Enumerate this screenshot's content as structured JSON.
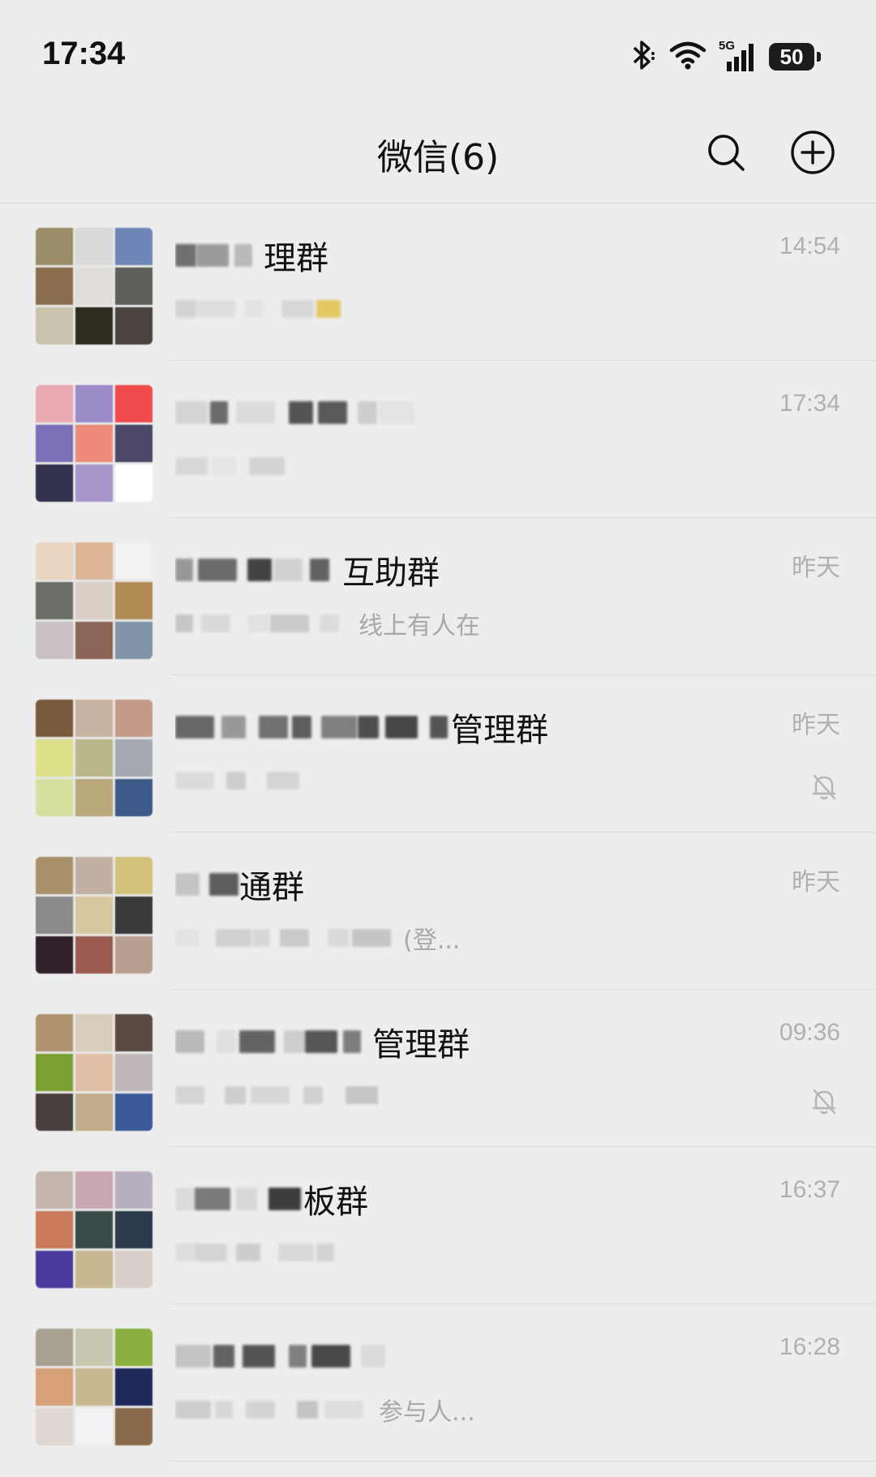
{
  "status_bar": {
    "time": "17:34",
    "icons": [
      "bluetooth-icon",
      "wifi-icon",
      "signal-5g-icon",
      "battery-icon"
    ],
    "network_label": "5G",
    "battery_level": "50"
  },
  "header": {
    "title": "微信(6)",
    "search_icon": "search-icon",
    "add_icon": "plus-circle-icon"
  },
  "chats": [
    {
      "name": "理群",
      "preview": "",
      "time": "14:54",
      "muted": false,
      "avatar_colors": [
        "#9b8c6a",
        "#d9d9d9",
        "#6f86b8",
        "#8b6e4e",
        "#e0dcd8",
        "#5c5e58",
        "#c9c2ad",
        "#2d2a20",
        "#4a423c"
      ],
      "name_blocks": [
        "#5a5a5a",
        "#8c8c8c",
        "#b0b0b0"
      ],
      "preview_blocks": [
        "#cfcfcf",
        "#dcdcdc",
        "#e2e2e2",
        "#d4d4d4",
        "#e3c24a"
      ]
    },
    {
      "name": "",
      "preview": "",
      "time": "17:34",
      "muted": false,
      "avatar_colors": [
        "#e8a9b2",
        "#9b8cc8",
        "#f24a4a",
        "#7b6fb5",
        "#ee8a7a",
        "#4a4866",
        "#33334d",
        "#a595c8",
        "#ffffff"
      ],
      "name_blocks": [
        "#d0d0d0",
        "#555555",
        "#dadada",
        "#3a3a3a",
        "#404040",
        "#c8c8c8",
        "#e2e2e2"
      ],
      "preview_blocks": [
        "#d4d4d4",
        "#e4e4e4",
        "#cfcfcf"
      ]
    },
    {
      "name": "互助群",
      "preview": "线上有人在",
      "time": "昨天",
      "muted": false,
      "avatar_colors": [
        "#e9d7c2",
        "#dcb697",
        "#f2f2f2",
        "#6a6e66",
        "#d9cec5",
        "#b08c54",
        "#c9c0c6",
        "#8c6456",
        "#7f94a6"
      ],
      "name_blocks": [
        "#8a8a8a",
        "#555555",
        "#262626",
        "#cdcdcd",
        "#4a4a4a"
      ],
      "preview_blocks": [
        "#c0c0c0",
        "#d6d6d6",
        "#e0e0e0",
        "#c4c4c4",
        "#dadada"
      ]
    },
    {
      "name": "管理群",
      "preview": "",
      "time": "昨天",
      "muted": true,
      "avatar_colors": [
        "#7a5a3a",
        "#c8b4a2",
        "#c49a8a",
        "#dce08a",
        "#b9b68a",
        "#a5aab2",
        "#d6e09e",
        "#b8a87a",
        "#3c5a8a"
      ],
      "name_blocks": [
        "#505050",
        "#8a8a8a",
        "#5c5c5c",
        "#454545",
        "#6c6c6c",
        "#333333",
        "#2a2a2a",
        "#3a3a3a"
      ],
      "preview_blocks": [
        "#d8d8d8",
        "#c8c8c8",
        "#d0d0d0"
      ]
    },
    {
      "name": "通群",
      "preview": "(登...",
      "time": "昨天",
      "muted": false,
      "avatar_colors": [
        "#a8906a",
        "#c2b0a2",
        "#d2c27a",
        "#8a8a8a",
        "#d8c8a0",
        "#3a3a3a",
        "#30202a",
        "#9a5a50",
        "#b8a090"
      ],
      "name_blocks": [
        "#bdbdbd",
        "#444444"
      ],
      "preview_blocks": [
        "#e2e2e2",
        "#cccccc",
        "#d4d4d4",
        "#c4c4c4",
        "#d6d6d6",
        "#bfbfbf"
      ]
    },
    {
      "name": "管理群",
      "preview": "",
      "time": "09:36",
      "muted": true,
      "avatar_colors": [
        "#b09470",
        "#d8cdb8",
        "#5a4a44",
        "#7aa030",
        "#e2c0a8",
        "#c0b8b8",
        "#4a4040",
        "#c0ac88",
        "#3a5a9a"
      ],
      "name_blocks": [
        "#b0b0b0",
        "#dedede",
        "#4c4c4c",
        "#c8c8c8",
        "#3c3c3c",
        "#6a6a6a"
      ],
      "preview_blocks": [
        "#d0d0d0",
        "#c8c8c8",
        "#d4d4d4",
        "#cccccc",
        "#c0c0c0"
      ]
    },
    {
      "name": "板群",
      "preview": "",
      "time": "16:37",
      "muted": false,
      "avatar_colors": [
        "#c6b6b0",
        "#c8a8b0",
        "#b8b0c0",
        "#c87a5a",
        "#3a4a48",
        "#2a3a4a",
        "#4a3aa0",
        "#c8b890",
        "#d8d0c8"
      ],
      "name_blocks": [
        "#d8d8d8",
        "#666666",
        "#d4d4d4",
        "#1e1e1e"
      ],
      "preview_blocks": [
        "#dcdcdc",
        "#d0d0d0",
        "#c8c8c8",
        "#d6d6d6",
        "#cfcfcf"
      ]
    },
    {
      "name": "",
      "preview": "参与人...",
      "time": "16:28",
      "muted": false,
      "avatar_colors": [
        "#a8a090",
        "#c8c8b0",
        "#8ab040",
        "#d8a078",
        "#c8b890",
        "#1e2a5a",
        "#e0d8d0",
        "#f2f2f2",
        "#8a6a4a"
      ],
      "name_blocks": [
        "#bcbcbc",
        "#4a4a4a",
        "#3a3a3a",
        "#6c6c6c",
        "#2c2c2c",
        "#d8d8d8"
      ],
      "preview_blocks": [
        "#c8c8c8",
        "#d4d4d4",
        "#cfcfcf",
        "#bdbdbd",
        "#dcdcdc"
      ]
    }
  ]
}
